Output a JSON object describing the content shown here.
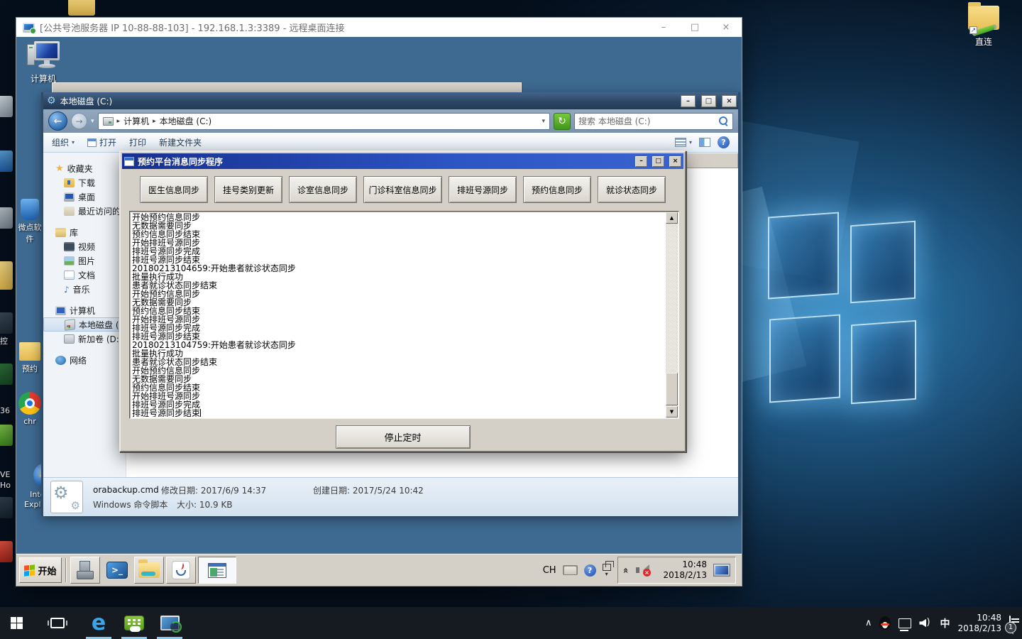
{
  "glyphs": {
    "star": "★",
    "music_note": "♪",
    "gear": "⚙",
    "back_arrow": "←",
    "forward_arrow": "→",
    "crumb_sep": "▸",
    "dropdown": "▾",
    "scroll_up": "▲",
    "scroll_down": "▼",
    "refresh": "↻",
    "help": "?",
    "minimize": "–",
    "maximize": "□",
    "close": "×",
    "powershell": ">_",
    "chevron_double": "»",
    "chevron_up": "∧",
    "edge_letter": "e",
    "mute_x": "×",
    "wave": ")"
  },
  "rdp": {
    "title": "[公共号池服务器 IP 10-88-88-103] - 192.168.1.3:3389 - 远程桌面连接"
  },
  "host": {
    "desktop": {
      "shortcut": "直连",
      "edge_labels": [
        "控",
        "36",
        "VE",
        "Ho"
      ]
    },
    "taskbar": {
      "ime": "中",
      "time": "10:48",
      "date": "2018/2/13",
      "badge": "1"
    }
  },
  "remote": {
    "desktop_icons": {
      "computer": "计算机",
      "weidian": "微点软件",
      "yuyue": "预约",
      "chrome": "chr",
      "ie_line1": "Internet",
      "ie_line2": "Explorer ..."
    },
    "taskbar": {
      "start": "开始",
      "lang": "CH",
      "time": "10:48",
      "date": "2018/2/13"
    }
  },
  "explorer": {
    "title": "本地磁盘 (C:)",
    "crumb_computer": "计算机",
    "crumb_disk": "本地磁盘 (C:)",
    "search": "搜索 本地磁盘 (C:)",
    "toolbar": {
      "organize": "组织",
      "open": "打开",
      "print": "打印",
      "new_folder": "新建文件夹"
    },
    "sidebar": {
      "favorites": "收藏夹",
      "downloads": "下载",
      "desktop": "桌面",
      "recent": "最近访问的位置",
      "libraries": "库",
      "videos": "视频",
      "pictures": "图片",
      "documents": "文档",
      "music": "音乐",
      "computer": "计算机",
      "local_disk": "本地磁盘 (C:)",
      "new_volume": "新加卷 (D:)",
      "network": "网络"
    },
    "details": {
      "filename": "orabackup.cmd",
      "modified": "修改日期: 2017/6/9 14:37",
      "created": "创建日期: 2017/5/24 10:42",
      "type": "Windows 命令脚本",
      "size": "大小: 10.9 KB"
    }
  },
  "dialog": {
    "title": "预约平台消息同步程序",
    "buttons": [
      "医生信息同步",
      "挂号类别更新",
      "诊室信息同步",
      "门诊科室信息同步",
      "排班号源同步",
      "预约信息同步",
      "就诊状态同步"
    ],
    "log": [
      "开始预约信息同步",
      "无数据需要同步",
      "预约信息同步结束",
      "开始排班号源同步",
      "排班号源同步完成",
      "排班号源同步结束",
      "20180213104659:开始患者就诊状态同步",
      "批量执行成功",
      "患者就诊状态同步结束",
      "开始预约信息同步",
      "无数据需要同步",
      "预约信息同步结束",
      "开始排班号源同步",
      "排班号源同步完成",
      "排班号源同步结束",
      "20180213104759:开始患者就诊状态同步",
      "批量执行成功",
      "患者就诊状态同步结束",
      "开始预约信息同步",
      "无数据需要同步",
      "预约信息同步结束",
      "开始排班号源同步",
      "排班号源同步完成",
      "排班号源同步结束"
    ],
    "stop": "停止定时"
  }
}
